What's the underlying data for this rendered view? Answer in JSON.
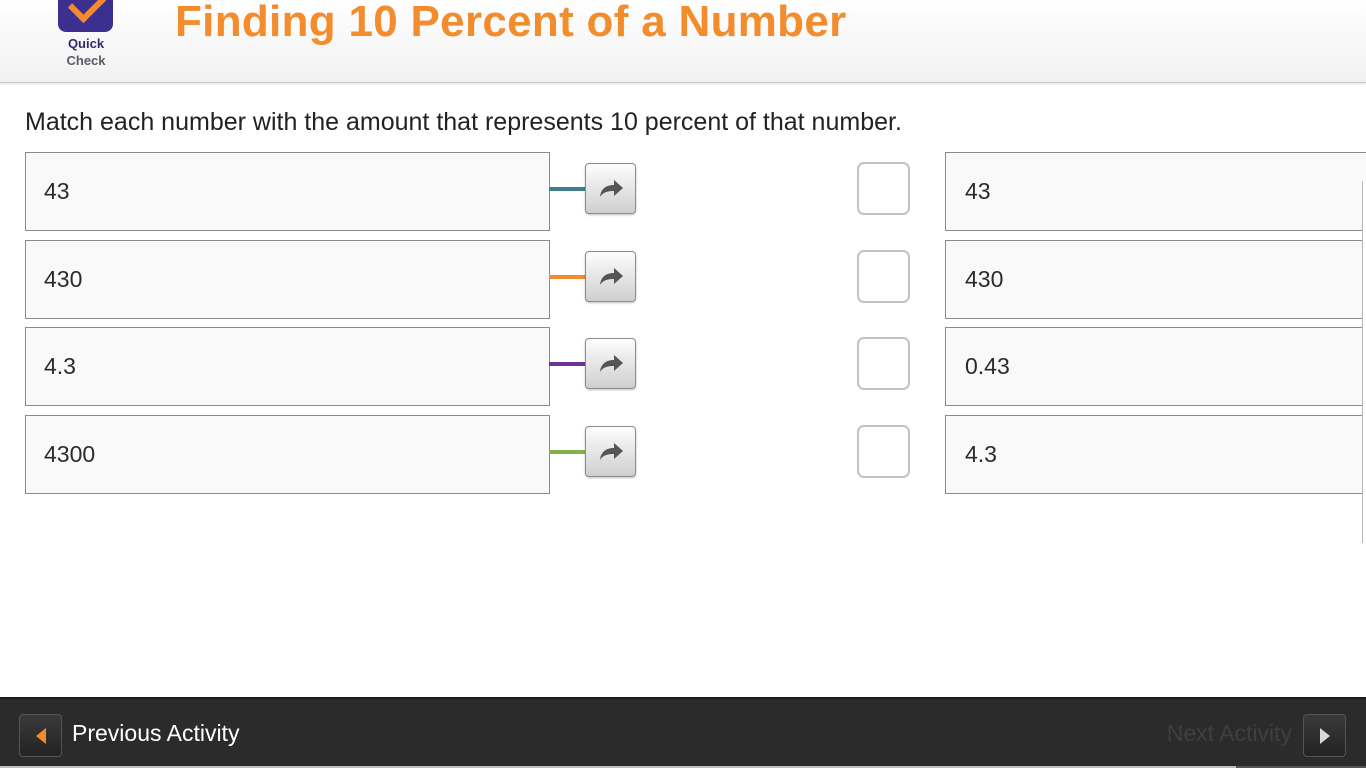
{
  "header": {
    "logo_line1": "Quick",
    "logo_line2": "Check",
    "title": "Finding 10 Percent of a Number"
  },
  "instructions": "Match each number with the amount that represents 10 percent of that number.",
  "left_items": [
    {
      "label": "43",
      "connector_color": "#3f7f8c"
    },
    {
      "label": "430",
      "connector_color": "#f28c2d"
    },
    {
      "label": "4.3",
      "connector_color": "#6b3392"
    },
    {
      "label": "4300",
      "connector_color": "#82b24a"
    }
  ],
  "right_items": [
    {
      "label": "43"
    },
    {
      "label": "430"
    },
    {
      "label": "0.43"
    },
    {
      "label": "4.3"
    }
  ],
  "icons": {
    "match_button": "curved-arrow-right-icon",
    "prev": "triangle-left-icon",
    "next": "triangle-right-icon"
  },
  "footer": {
    "prev_label": "Previous Activity",
    "next_label": "Next Activity",
    "progress_fraction": 0.905
  },
  "colors": {
    "title": "#f28c2d",
    "logo": "#3b2f8f",
    "footer_bg": "#2b2b2b"
  }
}
